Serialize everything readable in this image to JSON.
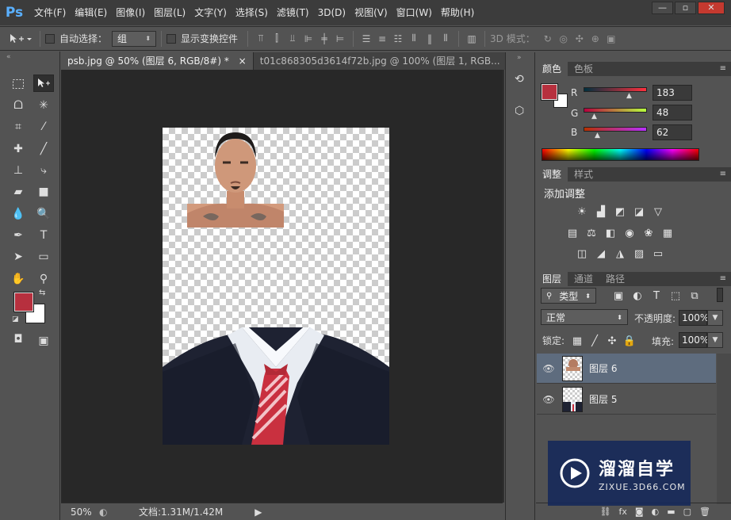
{
  "app": {
    "logo": "Ps"
  },
  "menu": [
    "文件(F)",
    "编辑(E)",
    "图像(I)",
    "图层(L)",
    "文字(Y)",
    "选择(S)",
    "滤镜(T)",
    "3D(D)",
    "视图(V)",
    "窗口(W)",
    "帮助(H)"
  ],
  "window_controls": {
    "minimize": "—",
    "maximize": "▫",
    "close": "✕"
  },
  "options": {
    "auto_select_label": "自动选择：",
    "auto_select_value": "组",
    "show_transform_label": "显示变换控件",
    "mode_3d_label": "3D 模式："
  },
  "tabs": [
    {
      "label": "psb.jpg @ 50% (图层 6, RGB/8#) *",
      "close": "×"
    },
    {
      "label": "t01c868305d3614f72b.jpg @ 100% (图层 1, RGB...",
      "close": "×"
    }
  ],
  "status": {
    "zoom": "50%",
    "doc_info": "文档:1.31M/1.42M"
  },
  "color_panel": {
    "tabs": [
      "颜色",
      "色板"
    ],
    "r_label": "R",
    "r_value": "183",
    "g_label": "G",
    "g_value": "48",
    "b_label": "B",
    "b_value": "62",
    "foreground": "#b7303e",
    "background": "#ffffff"
  },
  "adjust_panel": {
    "tabs": [
      "调整",
      "样式"
    ],
    "title": "添加调整"
  },
  "layers_panel": {
    "tabs": [
      "图层",
      "通道",
      "路径"
    ],
    "filter_label": "类型",
    "blend_mode": "正常",
    "opacity_label": "不透明度:",
    "opacity_value": "100%",
    "lock_label": "锁定:",
    "fill_label": "填充:",
    "fill_value": "100%",
    "layers": [
      {
        "name": "图层 6",
        "selected": true
      },
      {
        "name": "图层 5",
        "selected": false
      }
    ]
  },
  "watermark": {
    "title": "溜溜自学",
    "url": "ZIXUE.3D66.COM"
  },
  "icons": {
    "eye": "eye-icon",
    "move": "move-tool-icon",
    "brush": "brush-icon"
  }
}
